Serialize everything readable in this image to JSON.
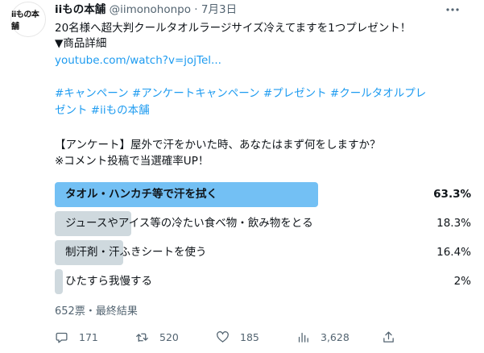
{
  "author": {
    "avatar_text": "iiもの本舗",
    "name": "iiもの本舗",
    "handle": "@iimonohonpo",
    "separator": "·",
    "date": "7月3日"
  },
  "tweet": {
    "line1": "20名様へ超大判クールタオルラージサイズ冷えてますを1つプレゼント！",
    "line2": "▼商品詳細",
    "link": "youtube.com/watch?v=jojTel...",
    "hashtags_line1": "#キャンペーン #アンケートキャンペーン #プレゼント #クールタオルプレ",
    "hashtags_line2": "ゼント #iiもの本舗",
    "question": "【アンケート】屋外で汗をかいた時、あなたはまず何をしますか？",
    "note": "※コメント投稿で当選確率UP！"
  },
  "poll": {
    "options": [
      {
        "label": "タオル・ハンカチ等で汗を拭く",
        "percent_text": "63.3%",
        "percent": 63.3,
        "winner": true
      },
      {
        "label": "ジュースやアイス等の冷たい食べ物・飲み物をとる",
        "percent_text": "18.3%",
        "percent": 18.3,
        "winner": false
      },
      {
        "label": "制汗剤・汗ふきシートを使う",
        "percent_text": "16.4%",
        "percent": 16.4,
        "winner": false
      },
      {
        "label": "ひたすら我慢する",
        "percent_text": "2%",
        "percent": 2,
        "winner": false
      }
    ],
    "meta": "652票・最終結果"
  },
  "actions": {
    "reply": "171",
    "retweet": "520",
    "like": "185",
    "views": "3,628"
  },
  "colors": {
    "winner_bar": "#73c0f4",
    "other_bar": "#cfd9de",
    "link": "#1d9bf0",
    "muted": "#536471"
  }
}
